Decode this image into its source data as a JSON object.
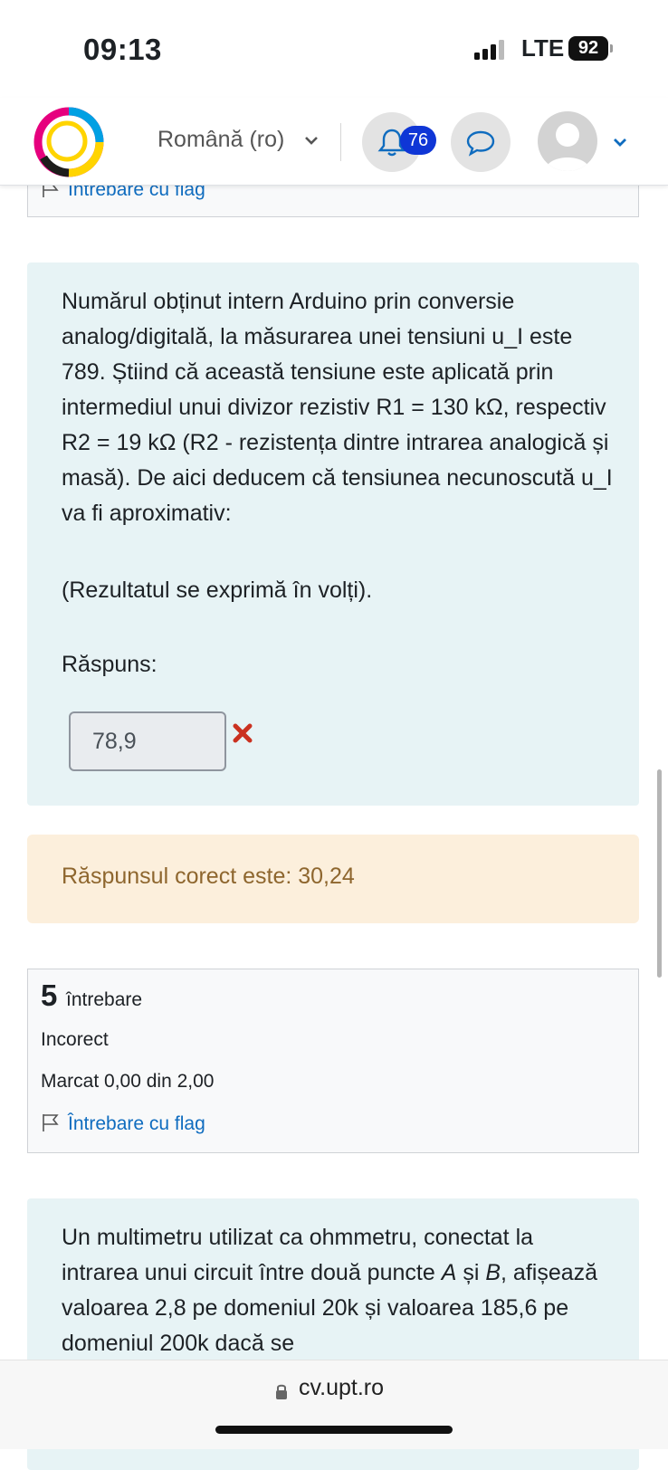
{
  "status": {
    "time": "09:13",
    "network": "LTE",
    "battery": "92"
  },
  "header": {
    "language": "Română (ro)",
    "notifications_count": "76"
  },
  "prev_question": {
    "flag_label": "Întrebare cu flag"
  },
  "question4": {
    "text": "Numărul obținut intern Arduino prin conversie analog/digitală, la măsurarea unei tensiuni u_I este 789. Știind că această tensiune este aplicată prin intermediul unui divizor rezistiv R1 =  130 kΩ, respectiv R2 = 19 kΩ (R2 - rezistența dintre intrarea analogică și masă). De aici deducem că tensiunea necunoscută u_I va fi aproximativ:",
    "note": "(Rezultatul se exprimă în volți).",
    "answer_label": "Răspuns:",
    "answer_value": "78,9",
    "feedback": "Răspunsul corect este: 30,24"
  },
  "question5": {
    "number": "5",
    "word": "întrebare",
    "state": "Incorect",
    "grade": "Marcat 0,00 din 2,00",
    "flag_label": "Întrebare cu flag",
    "text_before_a": "Un multimetru utilizat ca ohmmetru, conectat la intrarea unui circuit între două puncte ",
    "point_a": "A",
    "text_and": " și ",
    "point_b": "B",
    "text_after_b": ", afișează valoarea 2,8 pe domeniul 20k și valoarea 185,6 pe domeniul 200k dacă se"
  },
  "browser": {
    "url": "cv.upt.ro"
  },
  "colors": {
    "link": "#0f6cbf",
    "badge": "#0f36d6",
    "question_bg": "#e7f3f5",
    "feedback_bg": "#fcefdc",
    "feedback_text": "#8e662e",
    "error": "#ca3120"
  }
}
